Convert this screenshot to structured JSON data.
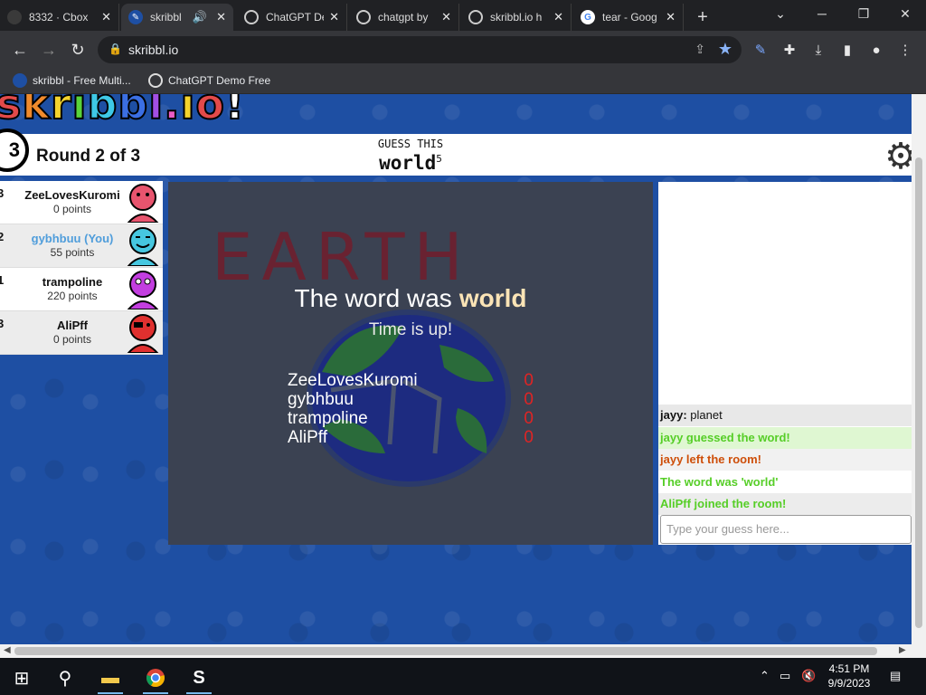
{
  "browser": {
    "tabs": [
      {
        "title": "8332 · Cbox",
        "active": false
      },
      {
        "title": "skribbl",
        "active": true
      },
      {
        "title": "ChatGPT De",
        "active": false
      },
      {
        "title": "chatgpt by",
        "active": false
      },
      {
        "title": "skribbl.io h",
        "active": false
      },
      {
        "title": "tear - Goog",
        "active": false
      }
    ],
    "new_tab_label": "+",
    "url": "skribbl.io",
    "bookmarks": [
      {
        "label": "skribbl - Free Multi..."
      },
      {
        "label": "ChatGPT Demo Free"
      }
    ]
  },
  "game": {
    "logo": "skribbl.io",
    "timer": "3",
    "round": "Round 2 of 3",
    "guess_label": "GUESS THIS",
    "word": "world",
    "word_length": "5",
    "players": [
      {
        "rank": "3",
        "name": "ZeeLovesKuromi",
        "points": "0 points",
        "you": false,
        "avatar_color": "#e8546e"
      },
      {
        "rank": "2",
        "name": "gybhbuu (You)",
        "points": "55 points",
        "you": true,
        "avatar_color": "#46c7e0"
      },
      {
        "rank": "1",
        "name": "trampoline",
        "points": "220 points",
        "you": false,
        "avatar_color": "#c33ee0"
      },
      {
        "rank": "3",
        "name": "AliPff",
        "points": "0 points",
        "you": false,
        "avatar_color": "#e0302f"
      }
    ],
    "canvas": {
      "drawing_text": "EARTH",
      "overlay_title_prefix": "The word was",
      "overlay_word": "world",
      "overlay_subtitle": "Time is up!",
      "scores": [
        {
          "name": "ZeeLovesKuromi",
          "score": "0"
        },
        {
          "name": "gybhbuu",
          "score": "0"
        },
        {
          "name": "trampoline",
          "score": "0"
        },
        {
          "name": "AliPff",
          "score": "0"
        }
      ]
    },
    "chat": {
      "messages": [
        {
          "author": "jayy",
          "text": " planet",
          "type": "normal"
        },
        {
          "text": "jayy guessed the word!",
          "type": "green"
        },
        {
          "text": "jayy left the room!",
          "type": "red"
        },
        {
          "text": "The word was 'world'",
          "type": "green2"
        },
        {
          "text": "AliPff joined the room!",
          "type": "green3"
        }
      ],
      "input_placeholder": "Type your guess here..."
    }
  },
  "taskbar": {
    "time": "4:51 PM",
    "date": "9/9/2023"
  },
  "colors": {
    "page_bg": "#1e4fa3",
    "canvas_bg": "#3b4252",
    "overlay_word": "#fbe4b6",
    "score_red": "#e02424",
    "chat_green": "#56ce27",
    "chat_red": "#ce4f0a"
  }
}
